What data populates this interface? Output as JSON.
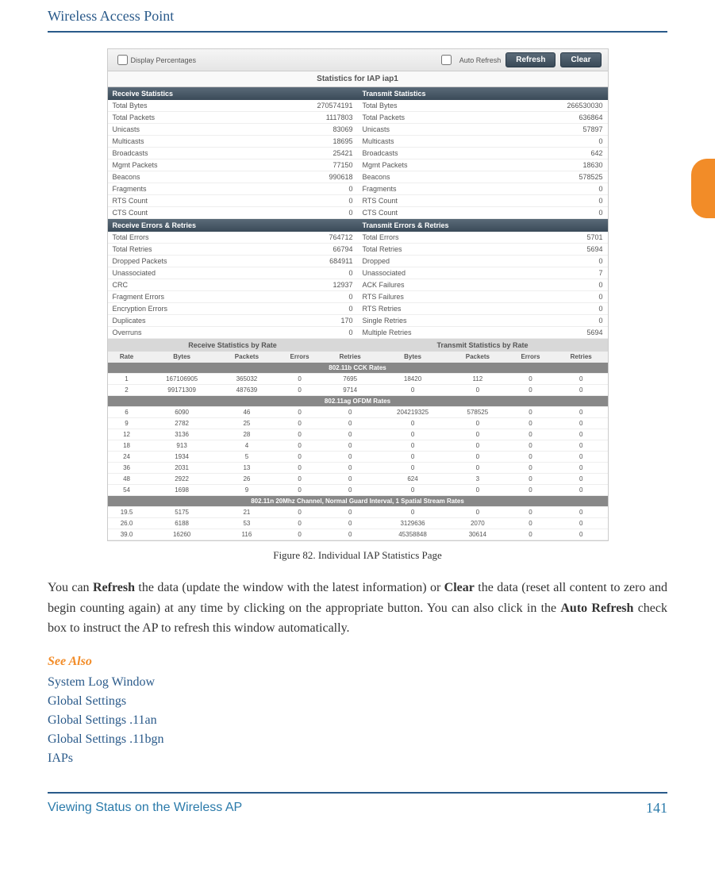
{
  "header": "Wireless Access Point",
  "toolbar": {
    "display_percentages": "Display Percentages",
    "auto_refresh": "Auto Refresh",
    "refresh_btn": "Refresh",
    "clear_btn": "Clear"
  },
  "stats_title": "Statistics for IAP iap1",
  "sections": {
    "receive_stats": "Receive Statistics",
    "transmit_stats": "Transmit Statistics",
    "receive_errors": "Receive Errors & Retries",
    "transmit_errors": "Transmit Errors & Retries",
    "receive_by_rate": "Receive Statistics by Rate",
    "transmit_by_rate": "Transmit Statistics by Rate"
  },
  "receive_stats": [
    {
      "label": "Total Bytes",
      "value": "270574191"
    },
    {
      "label": "Total Packets",
      "value": "1117803"
    },
    {
      "label": "Unicasts",
      "value": "83069"
    },
    {
      "label": "Multicasts",
      "value": "18695"
    },
    {
      "label": "Broadcasts",
      "value": "25421"
    },
    {
      "label": "Mgmt Packets",
      "value": "77150"
    },
    {
      "label": "Beacons",
      "value": "990618"
    },
    {
      "label": "Fragments",
      "value": "0"
    },
    {
      "label": "RTS Count",
      "value": "0"
    },
    {
      "label": "CTS Count",
      "value": "0"
    }
  ],
  "transmit_stats": [
    {
      "label": "Total Bytes",
      "value": "266530030"
    },
    {
      "label": "Total Packets",
      "value": "636864"
    },
    {
      "label": "Unicasts",
      "value": "57897"
    },
    {
      "label": "Multicasts",
      "value": "0"
    },
    {
      "label": "Broadcasts",
      "value": "642"
    },
    {
      "label": "Mgmt Packets",
      "value": "18630"
    },
    {
      "label": "Beacons",
      "value": "578525"
    },
    {
      "label": "Fragments",
      "value": "0"
    },
    {
      "label": "RTS Count",
      "value": "0"
    },
    {
      "label": "CTS Count",
      "value": "0"
    }
  ],
  "receive_errors": [
    {
      "label": "Total Errors",
      "value": "764712"
    },
    {
      "label": "Total Retries",
      "value": "66794"
    },
    {
      "label": "Dropped Packets",
      "value": "684911"
    },
    {
      "label": "Unassociated",
      "value": "0"
    },
    {
      "label": "CRC",
      "value": "12937"
    },
    {
      "label": "Fragment Errors",
      "value": "0"
    },
    {
      "label": "Encryption Errors",
      "value": "0"
    },
    {
      "label": "Duplicates",
      "value": "170"
    },
    {
      "label": "Overruns",
      "value": "0"
    }
  ],
  "transmit_errors": [
    {
      "label": "Total Errors",
      "value": "5701"
    },
    {
      "label": "Total Retries",
      "value": "5694"
    },
    {
      "label": "Dropped",
      "value": "0"
    },
    {
      "label": "Unassociated",
      "value": "7"
    },
    {
      "label": "ACK Failures",
      "value": "0"
    },
    {
      "label": "RTS Failures",
      "value": "0"
    },
    {
      "label": "RTS Retries",
      "value": "0"
    },
    {
      "label": "Single Retries",
      "value": "0"
    },
    {
      "label": "Multiple Retries",
      "value": "5694"
    }
  ],
  "rate_columns": [
    "Rate",
    "Bytes",
    "Packets",
    "Errors",
    "Retries",
    "Bytes",
    "Packets",
    "Errors",
    "Retries"
  ],
  "rate_sections": [
    {
      "title": "802.11b CCK Rates",
      "rows": [
        [
          "1",
          "167106905",
          "365032",
          "0",
          "7695",
          "18420",
          "112",
          "0",
          "0"
        ],
        [
          "2",
          "99171309",
          "487639",
          "0",
          "9714",
          "0",
          "0",
          "0",
          "0"
        ]
      ]
    },
    {
      "title": "802.11ag OFDM Rates",
      "rows": [
        [
          "6",
          "6090",
          "46",
          "0",
          "0",
          "204219325",
          "578525",
          "0",
          "0"
        ],
        [
          "9",
          "2782",
          "25",
          "0",
          "0",
          "0",
          "0",
          "0",
          "0"
        ],
        [
          "12",
          "3136",
          "28",
          "0",
          "0",
          "0",
          "0",
          "0",
          "0"
        ],
        [
          "18",
          "913",
          "4",
          "0",
          "0",
          "0",
          "0",
          "0",
          "0"
        ],
        [
          "24",
          "1934",
          "5",
          "0",
          "0",
          "0",
          "0",
          "0",
          "0"
        ],
        [
          "36",
          "2031",
          "13",
          "0",
          "0",
          "0",
          "0",
          "0",
          "0"
        ],
        [
          "48",
          "2922",
          "26",
          "0",
          "0",
          "624",
          "3",
          "0",
          "0"
        ],
        [
          "54",
          "1698",
          "9",
          "0",
          "0",
          "0",
          "0",
          "0",
          "0"
        ]
      ]
    },
    {
      "title": "802.11n 20Mhz Channel, Normal Guard Interval, 1 Spatial Stream Rates",
      "rows": [
        [
          "19.5",
          "5175",
          "21",
          "0",
          "0",
          "0",
          "0",
          "0",
          "0"
        ],
        [
          "26.0",
          "6188",
          "53",
          "0",
          "0",
          "3129636",
          "2070",
          "0",
          "0"
        ],
        [
          "39.0",
          "16260",
          "116",
          "0",
          "0",
          "45358848",
          "30614",
          "0",
          "0"
        ]
      ]
    }
  ],
  "figure_caption": "Figure 82. Individual IAP Statistics Page",
  "body_text": {
    "p1_1": "You can ",
    "p1_refresh": "Refresh",
    "p1_2": " the data (update the window with the latest information) or ",
    "p1_clear": "Clear",
    "p1_3": " the data (reset all content to zero and begin counting again) at any time by clicking on the appropriate button. You can also click in the ",
    "p1_auto": "Auto Refresh",
    "p1_4": " check box to instruct the AP to refresh this window automatically."
  },
  "see_also": {
    "heading": "See Also",
    "links": [
      "System Log Window",
      "Global Settings",
      "Global Settings .11an",
      "Global Settings .11bgn",
      "IAPs"
    ]
  },
  "footer": {
    "text": "Viewing Status on the Wireless AP",
    "page": "141"
  }
}
